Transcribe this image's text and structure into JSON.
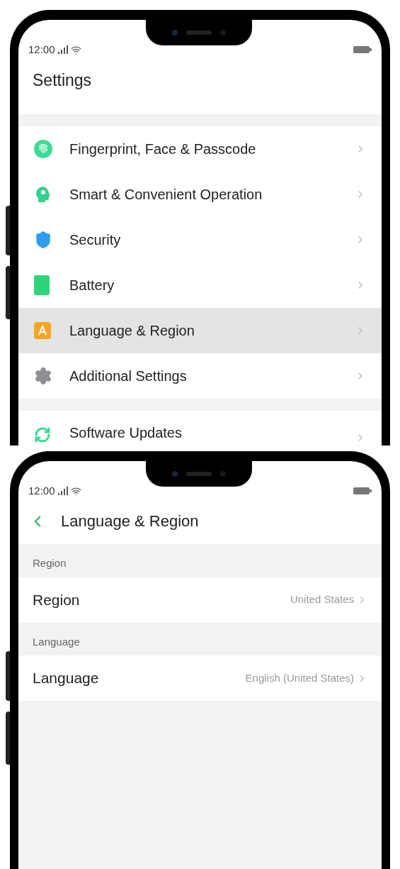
{
  "screens": [
    {
      "kind": "list",
      "status_bar": {
        "time": "12:00"
      },
      "title": "Settings",
      "groups": [
        {
          "items": [
            {
              "label": "Fingerprint, Face & Passcode",
              "color": "#3ddc97",
              "selected": false
            },
            {
              "label": "Smart & Convenient Operation",
              "color": "#35d08a",
              "selected": false
            },
            {
              "label": "Security",
              "color": "#2f9ded",
              "selected": false
            },
            {
              "label": "Battery",
              "color": "#2ed47a",
              "selected": false
            },
            {
              "label": "Language & Region",
              "color": "#f5a623",
              "selected": true
            },
            {
              "label": "Additional Settings",
              "color": "#8e8e93",
              "selected": false
            }
          ]
        },
        {
          "items": [
            {
              "label": "Software Updates",
              "color": "#3ddc97",
              "selected": false
            }
          ]
        }
      ]
    },
    {
      "kind": "detail",
      "status_bar": {
        "time": "12:00"
      },
      "title": "Language & Region",
      "sections": [
        {
          "header": "Region",
          "items": [
            {
              "label": "Region",
              "value": "United States"
            }
          ]
        },
        {
          "header": "Language",
          "items": [
            {
              "label": "Language",
              "value": "English (United States)"
            }
          ]
        }
      ]
    }
  ]
}
